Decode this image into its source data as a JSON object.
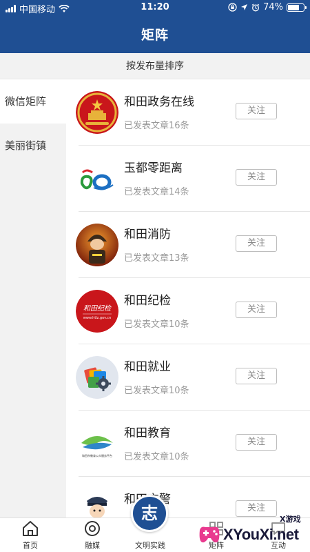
{
  "status_bar": {
    "carrier": "中国移动",
    "time": "11:20",
    "battery_percent": "74%",
    "battery_level": 0.74
  },
  "nav": {
    "title": "矩阵"
  },
  "sort_bar": {
    "label": "按发布量排序"
  },
  "sidebar": {
    "items": [
      {
        "label": "微信矩阵",
        "active": true
      },
      {
        "label": "美丽街镇",
        "active": false
      }
    ]
  },
  "list": {
    "rows": [
      {
        "title": "和田政务在线",
        "subtitle": "已发表文章16条",
        "button": "关注",
        "icon": "national-emblem-icon"
      },
      {
        "title": "玉都零距离",
        "subtitle": "已发表文章14条",
        "button": "关注",
        "icon": "anniversary-60-logo-icon"
      },
      {
        "title": "和田消防",
        "subtitle": "已发表文章13条",
        "button": "关注",
        "icon": "firefighter-avatar-icon"
      },
      {
        "title": "和田纪检",
        "subtitle": "已发表文章10条",
        "button": "关注",
        "icon": "discipline-inspection-logo-icon",
        "logo_text": "和田纪检",
        "logo_url": "www.htlz.gov.cn"
      },
      {
        "title": "和田就业",
        "subtitle": "已发表文章10条",
        "button": "关注",
        "icon": "employment-logo-icon"
      },
      {
        "title": "和田教育",
        "subtitle": "已发表文章10条",
        "button": "关注",
        "icon": "education-logo-icon",
        "logo_caption": "和田市教育公众服务平台"
      },
      {
        "title": "和田交警",
        "subtitle": "",
        "button": "关注",
        "icon": "traffic-police-avatar-icon"
      }
    ]
  },
  "tabbar": {
    "items": [
      {
        "label": "首页",
        "icon": "home-icon"
      },
      {
        "label": "融媒",
        "icon": "media-icon"
      },
      {
        "label": "文明实践",
        "icon": "civilization-practice-icon",
        "center_glyph": "志"
      },
      {
        "label": "矩阵",
        "icon": "matrix-icon"
      },
      {
        "label": "互动",
        "icon": "interact-icon"
      }
    ]
  },
  "watermark": {
    "text": "XYouXi.net",
    "small": "X游戏"
  },
  "colors": {
    "primary": "#1f4f93",
    "background_gray": "#f2f2f2",
    "muted_text": "#999999",
    "border": "#e5e5e5"
  }
}
